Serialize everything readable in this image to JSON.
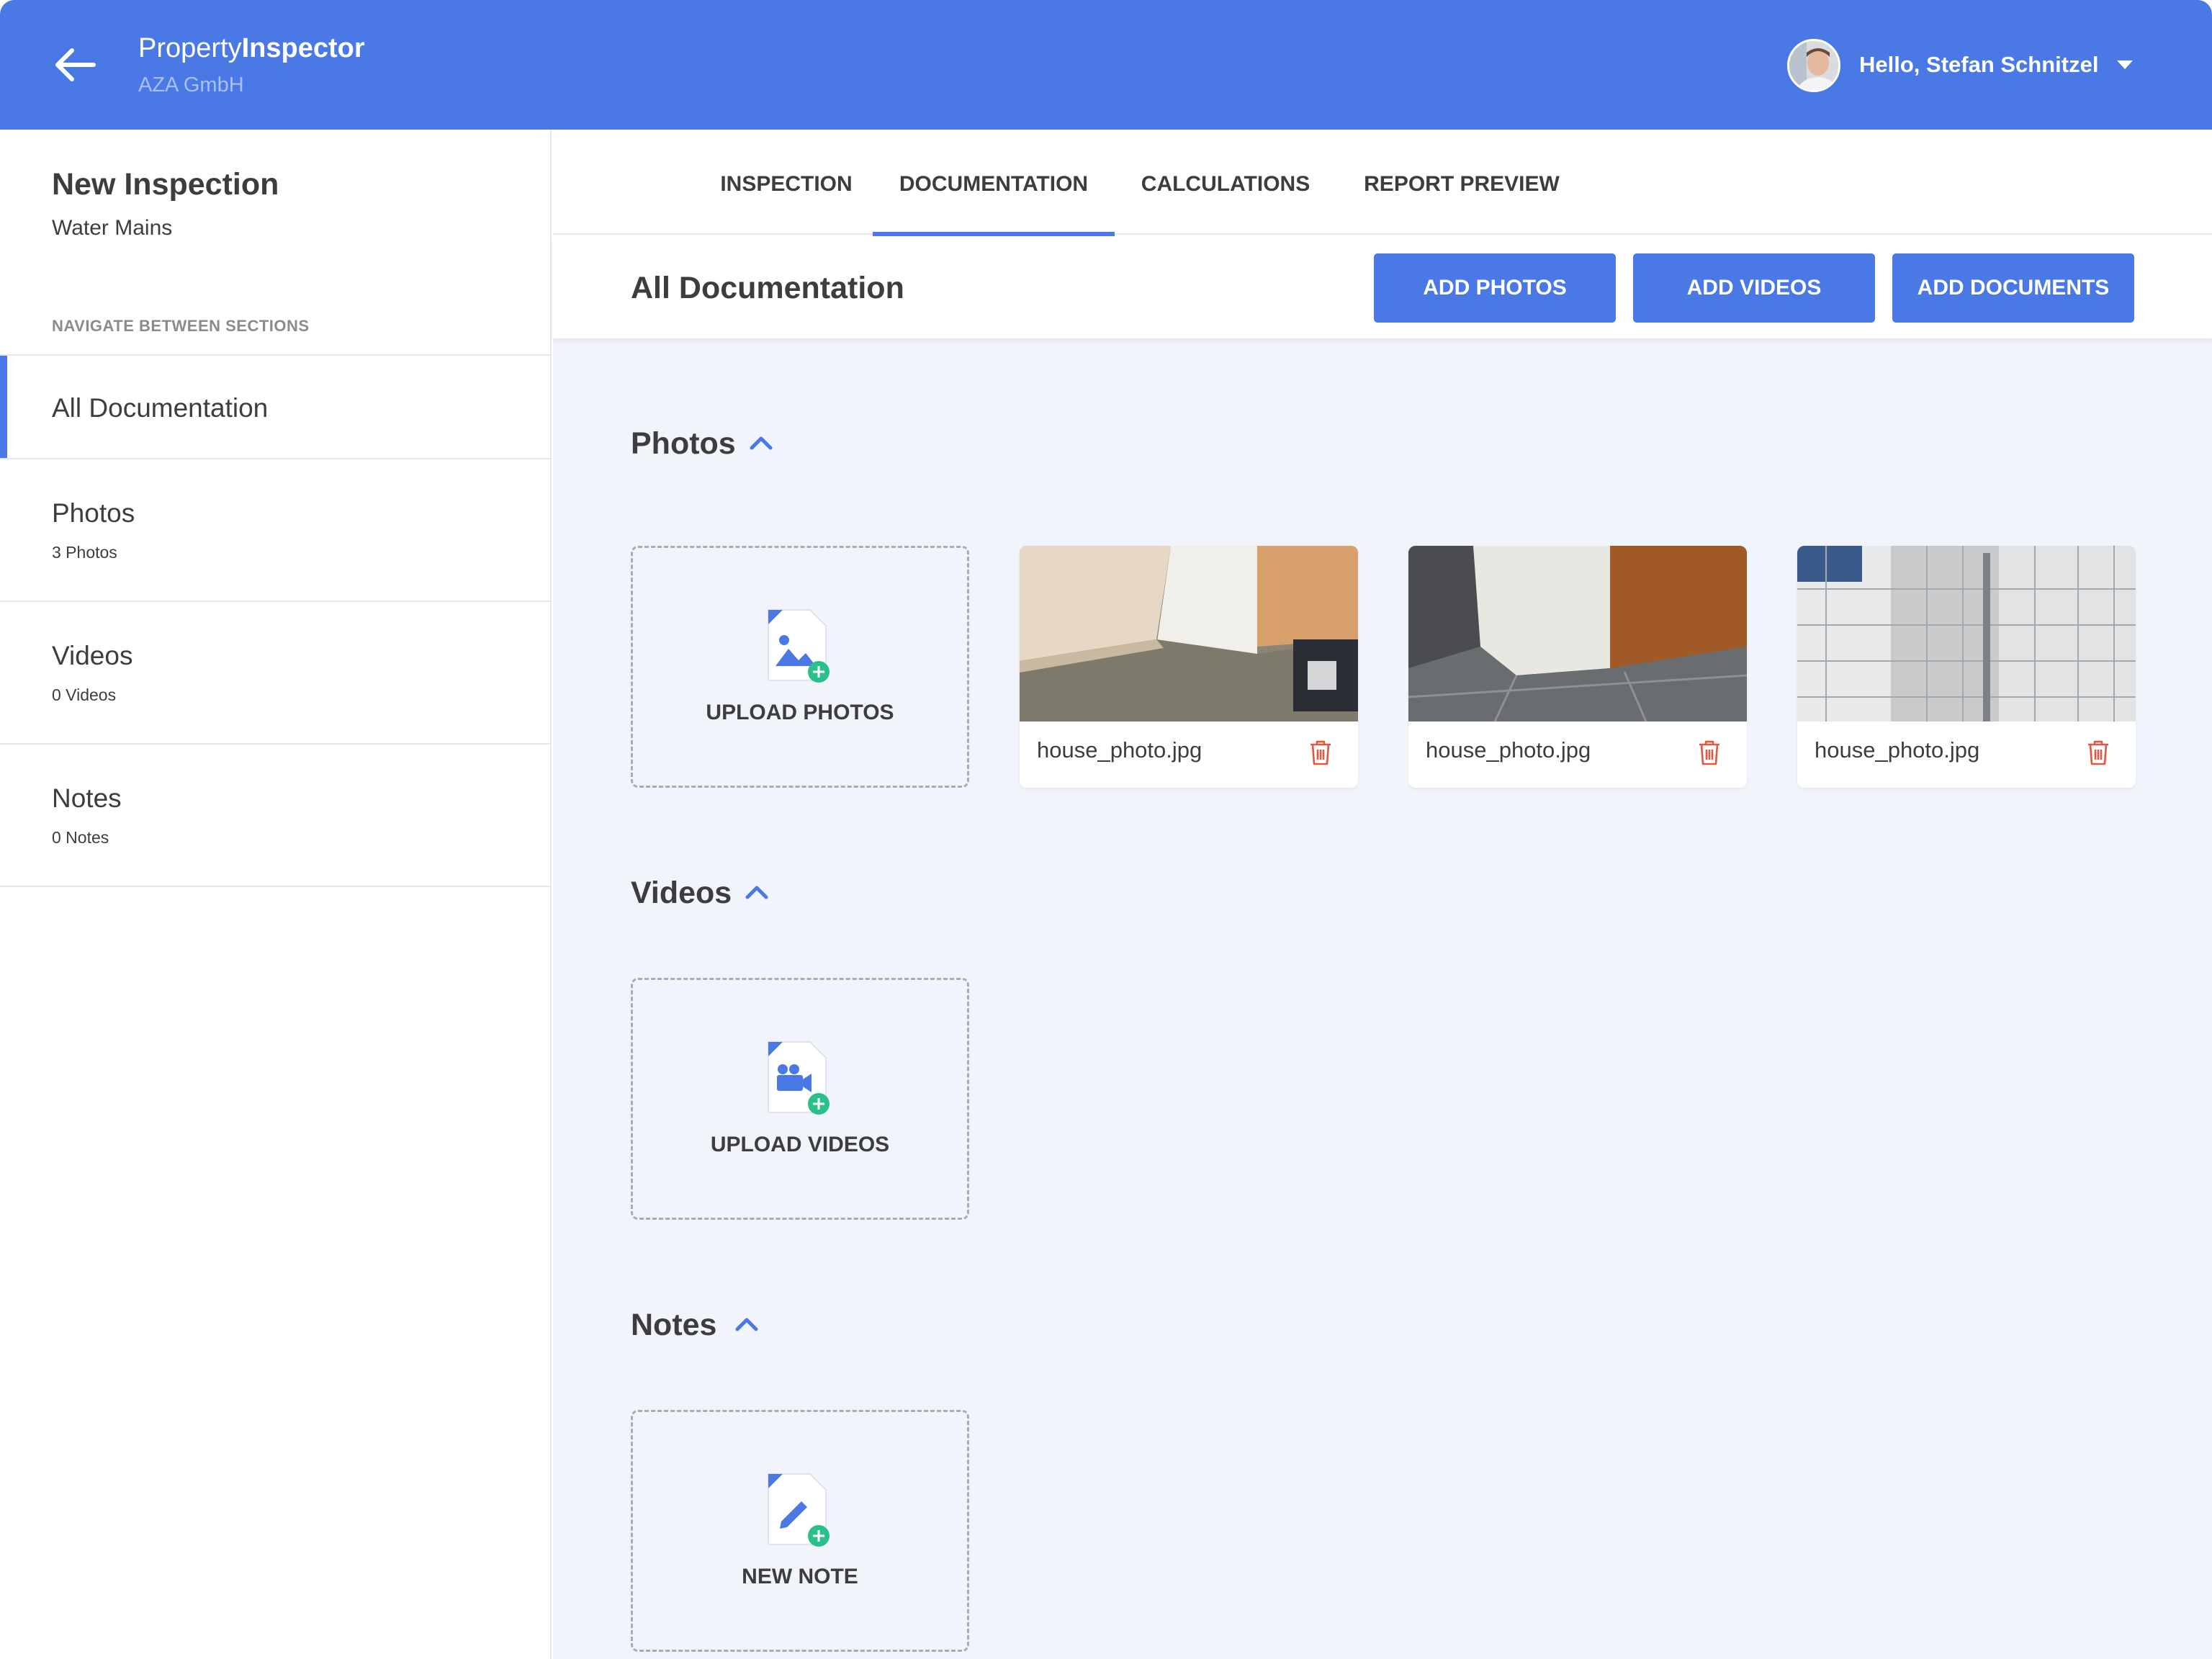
{
  "header": {
    "brand_light": "Property",
    "brand_bold": "Inspector",
    "company": "AZA GmbH",
    "greeting": "Hello, Stefan Schnitzel"
  },
  "sidebar": {
    "title": "New Inspection",
    "subtitle": "Water Mains",
    "nav_caption": "NAVIGATE BETWEEN SECTIONS",
    "items": [
      {
        "label": "All Documentation",
        "count": ""
      },
      {
        "label": "Photos",
        "count": "3 Photos"
      },
      {
        "label": "Videos",
        "count": "0 Videos"
      },
      {
        "label": "Notes",
        "count": "0 Notes"
      }
    ]
  },
  "tabs": [
    {
      "label": "INSPECTION"
    },
    {
      "label": "DOCUMENTATION"
    },
    {
      "label": "CALCULATIONS"
    },
    {
      "label": "REPORT PREVIEW"
    }
  ],
  "active_tab": "DOCUMENTATION",
  "subheader": {
    "title": "All Documentation",
    "buttons": {
      "add_photos": "ADD PHOTOS",
      "add_videos": "ADD VIDEOS",
      "add_documents": "ADD DOCUMENTS"
    }
  },
  "sections": {
    "photos": {
      "title": "Photos",
      "upload_label": "UPLOAD PHOTOS",
      "items": [
        {
          "filename": "house_photo.jpg"
        },
        {
          "filename": "house_photo.jpg"
        },
        {
          "filename": "house_photo.jpg"
        }
      ]
    },
    "videos": {
      "title": "Videos",
      "upload_label": "UPLOAD VIDEOS"
    },
    "notes": {
      "title": "Notes",
      "upload_label": "NEW NOTE"
    }
  },
  "colors": {
    "primary": "#4a78e4",
    "content_bg": "#f1f4fa",
    "add_badge": "#2bbf8a",
    "delete": "#e2583e"
  },
  "icons": {
    "back": "arrow-left-icon",
    "caret": "caret-down-icon",
    "collapse": "chevron-up-icon",
    "upload_photo": "file-image-plus-icon",
    "upload_video": "file-video-plus-icon",
    "new_note": "file-pencil-plus-icon",
    "delete": "trash-icon"
  }
}
